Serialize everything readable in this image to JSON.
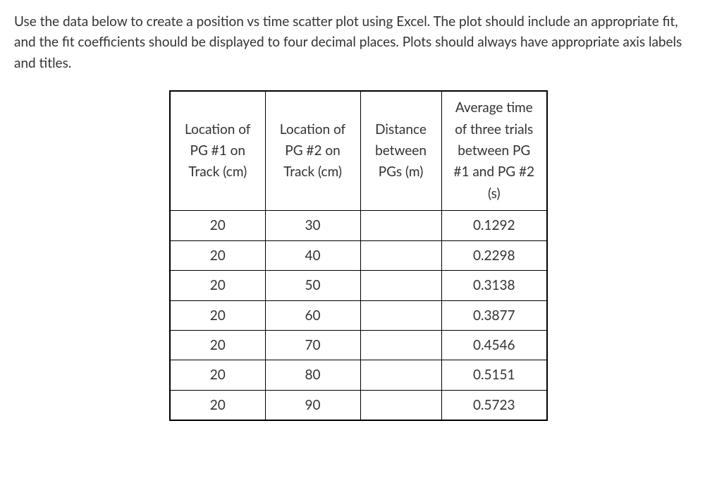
{
  "instructions": "Use the data below to create a position vs time scatter plot using Excel.  The plot should include  an appropriate fit, and the fit coefficients should be displayed to four decimal places.  Plots should always have appropriate axis labels and titles.",
  "headers": {
    "col_a": "Location of PG #1 on Track (cm)",
    "col_b": "Location of PG #2 on Track (cm)",
    "col_c": "Distance between PGs (m)",
    "col_d": "Average time of three trials between PG #1 and PG #2 (s)"
  },
  "rows": [
    {
      "a": "20",
      "b": "30",
      "c": "",
      "d": "0.1292"
    },
    {
      "a": "20",
      "b": "40",
      "c": "",
      "d": "0.2298"
    },
    {
      "a": "20",
      "b": "50",
      "c": "",
      "d": "0.3138"
    },
    {
      "a": "20",
      "b": "60",
      "c": "",
      "d": "0.3877"
    },
    {
      "a": "20",
      "b": "70",
      "c": "",
      "d": "0.4546"
    },
    {
      "a": "20",
      "b": "80",
      "c": "",
      "d": "0.5151"
    },
    {
      "a": "20",
      "b": "90",
      "c": "",
      "d": "0.5723"
    }
  ]
}
